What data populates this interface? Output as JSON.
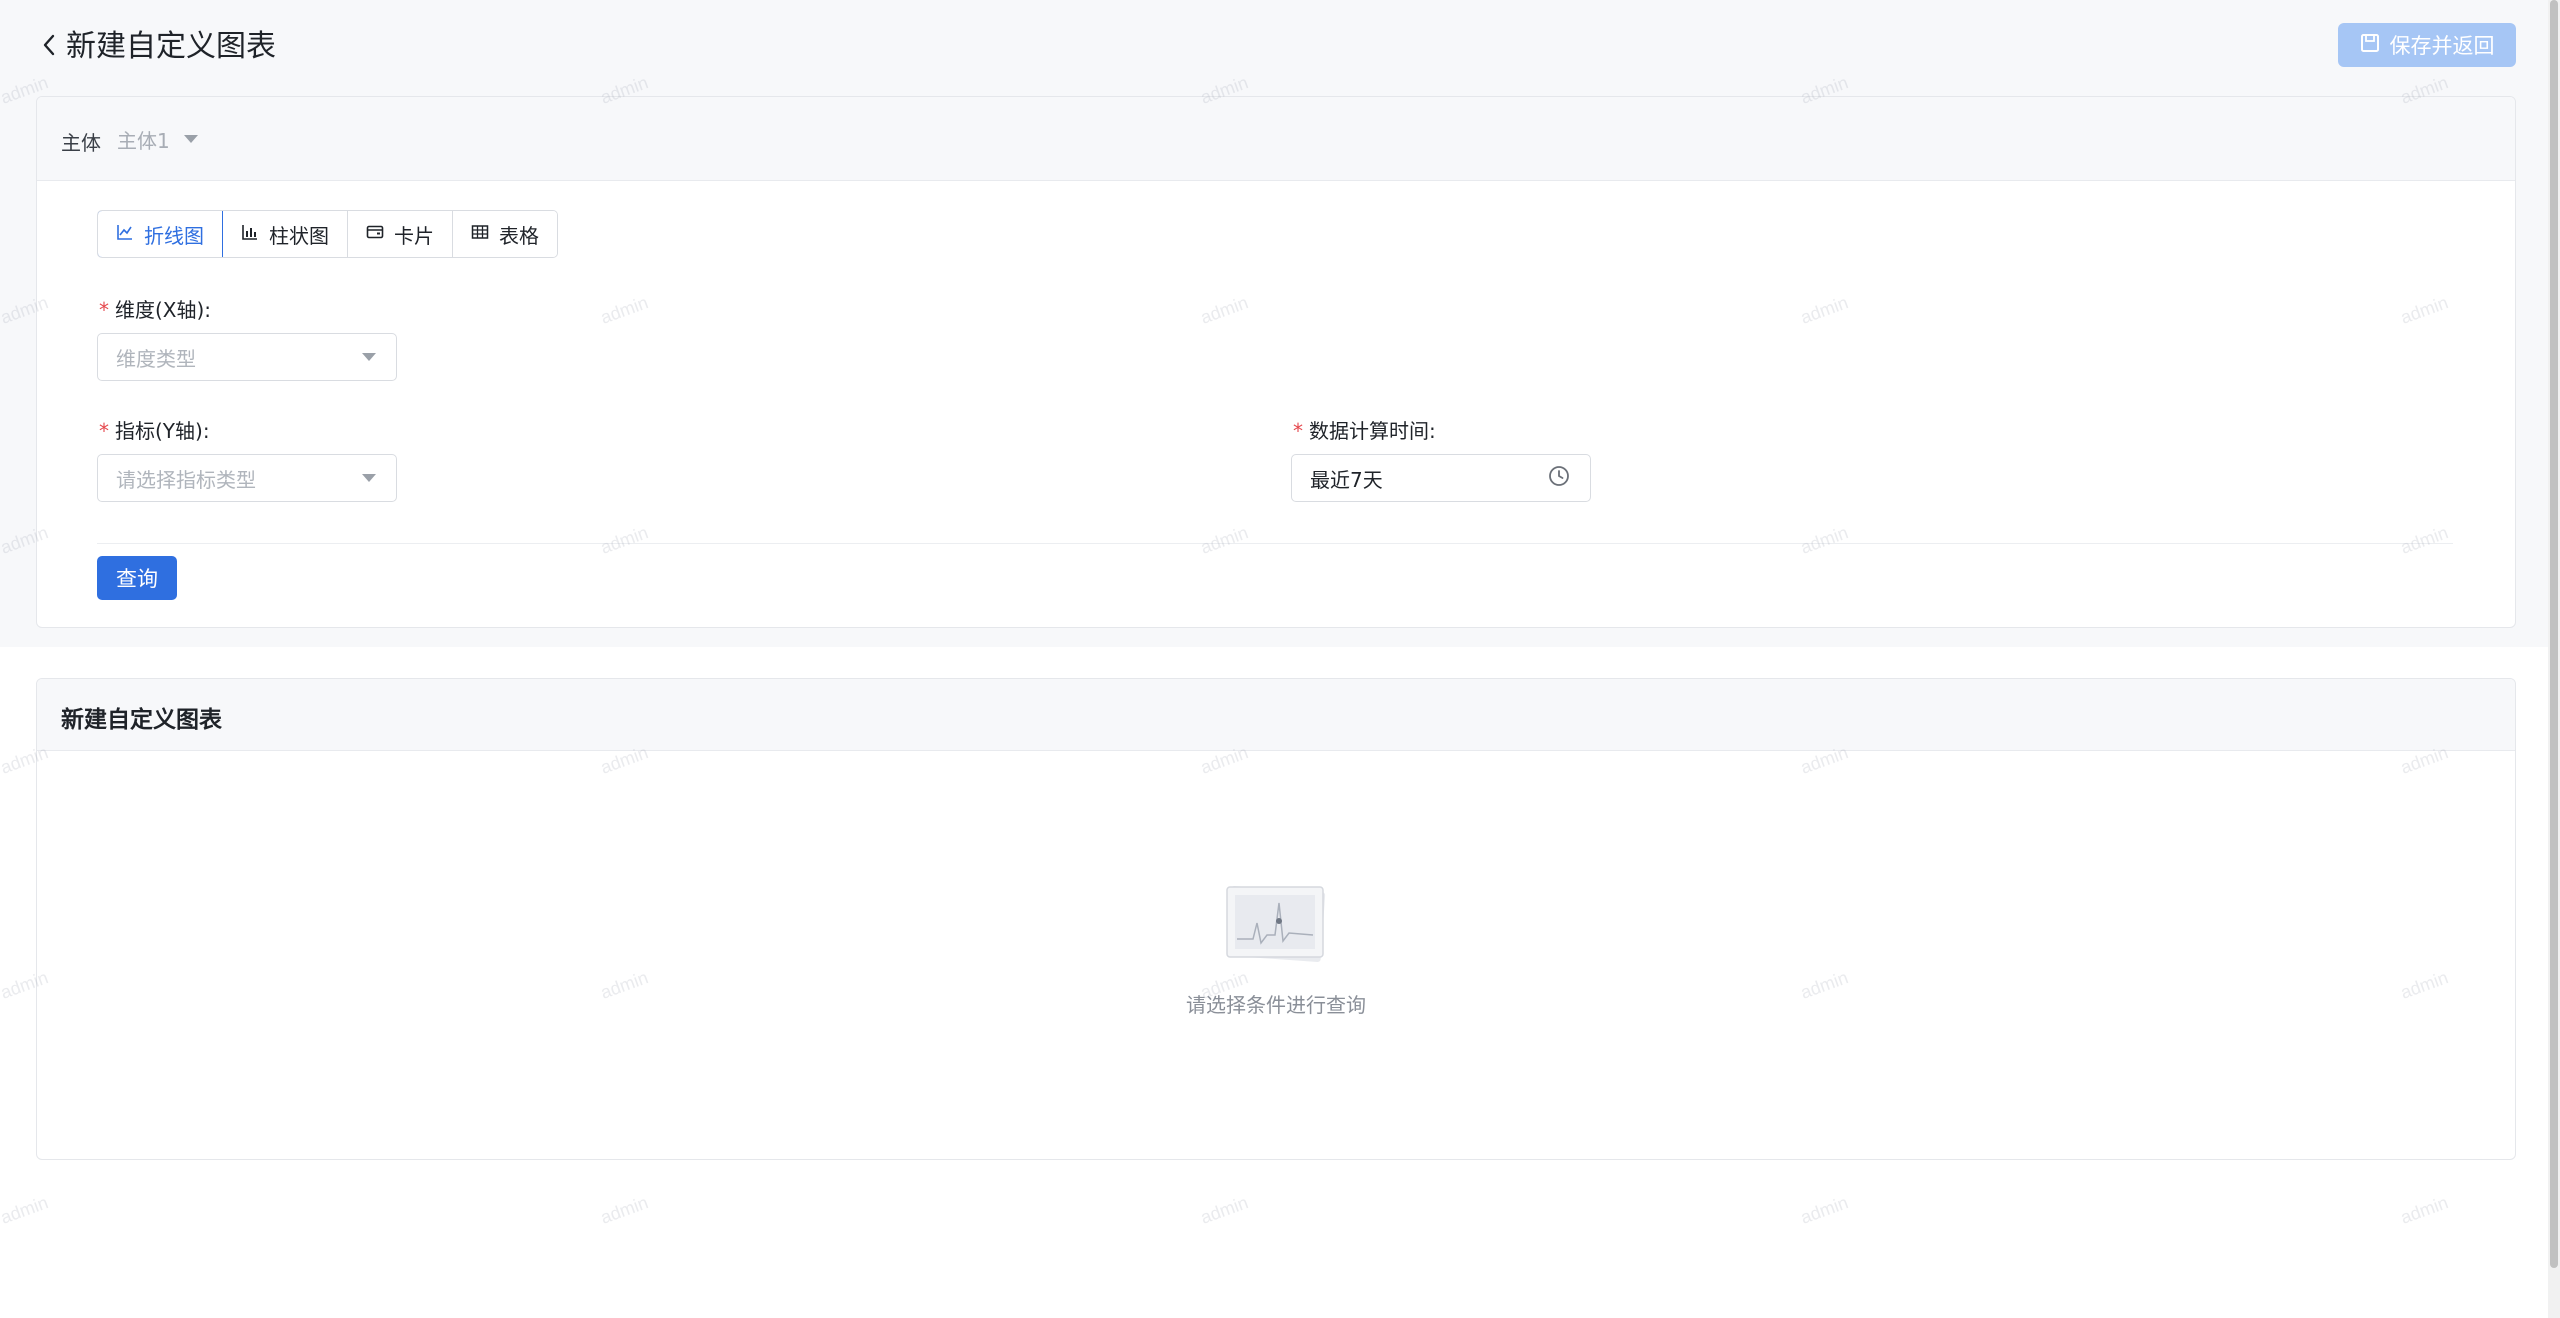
{
  "header": {
    "title": "新建自定义图表",
    "save_label": "保存并返回"
  },
  "subject": {
    "label": "主体",
    "value": "主体1"
  },
  "chart_types": [
    {
      "label": "折线图",
      "icon": "line-chart-icon",
      "active": true
    },
    {
      "label": "柱状图",
      "icon": "bar-chart-icon",
      "active": false
    },
    {
      "label": "卡片",
      "icon": "card-icon",
      "active": false
    },
    {
      "label": "表格",
      "icon": "table-icon",
      "active": false
    }
  ],
  "form": {
    "dimension": {
      "label": "维度(X轴):",
      "placeholder": "维度类型"
    },
    "metric": {
      "label": "指标(Y轴):",
      "placeholder": "请选择指标类型"
    },
    "time": {
      "label": "数据计算时间:",
      "value": "最近7天"
    },
    "query_label": "查询"
  },
  "result": {
    "title": "新建自定义图表",
    "empty_text": "请选择条件进行查询"
  },
  "watermark": "admin",
  "colors": {
    "primary": "#2f6fe0",
    "primary_disabled": "#a6c6f5",
    "required": "#e5484d",
    "page_bg": "#f7f8fa"
  }
}
